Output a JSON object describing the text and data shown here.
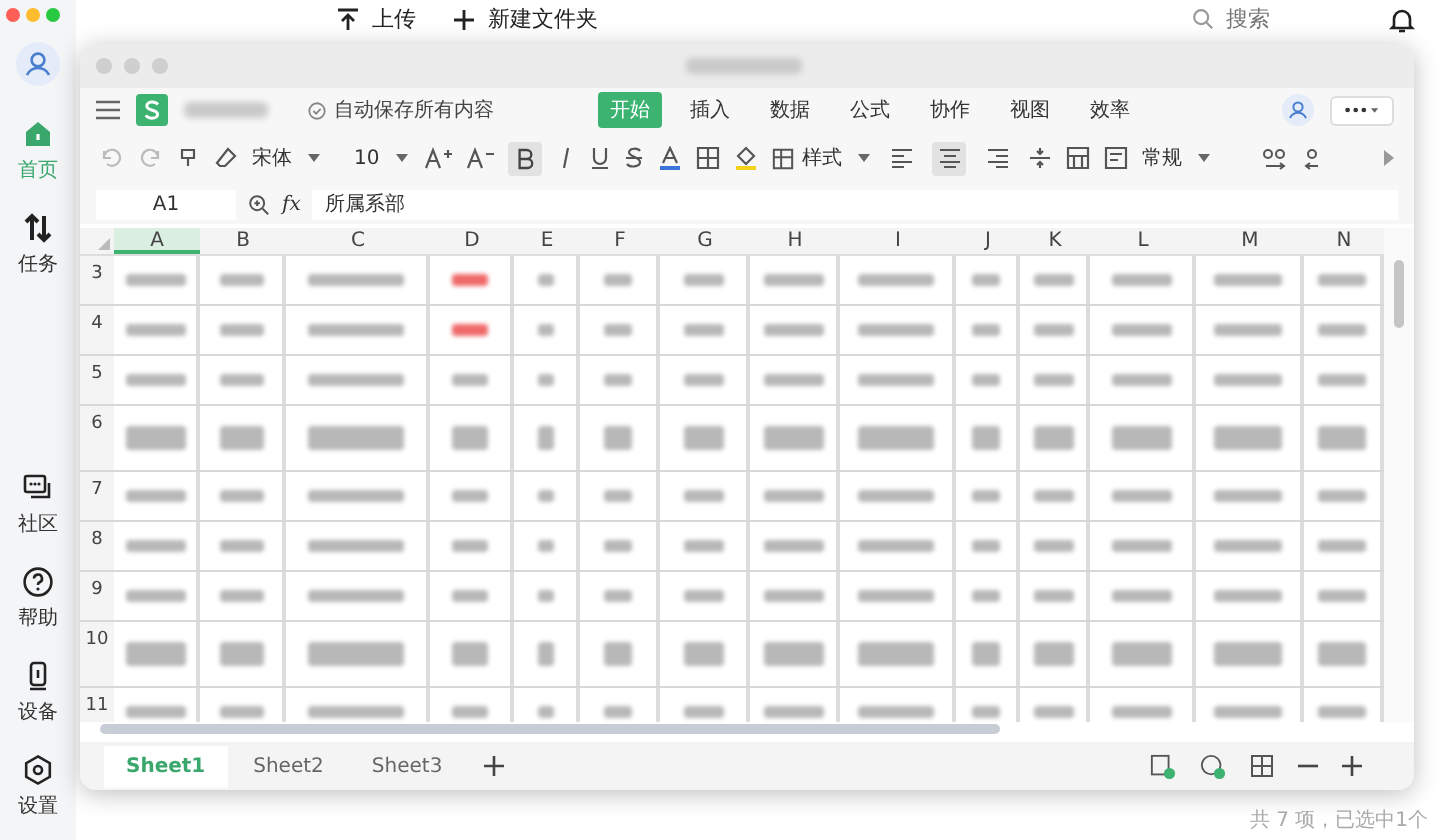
{
  "sidebar": {
    "top_items": [
      {
        "label": "首页",
        "kind": "home",
        "selected": true
      },
      {
        "label": "任务",
        "kind": "transfer",
        "selected": false
      }
    ],
    "bottom_items": [
      {
        "label": "社区",
        "kind": "chat",
        "selected": false
      },
      {
        "label": "帮助",
        "kind": "help",
        "selected": false
      },
      {
        "label": "设备",
        "kind": "device",
        "selected": false
      },
      {
        "label": "设置",
        "kind": "settings",
        "selected": false
      }
    ]
  },
  "background_toolbar": {
    "upload": "上传",
    "new_folder": "新建文件夹",
    "search": {
      "placeholder": "搜索"
    }
  },
  "status_text": "共 7 项，已选中1个",
  "editor": {
    "autosave": "自动保存所有内容",
    "menu_tabs": [
      {
        "label": "开始",
        "selected": true
      },
      {
        "label": "插入",
        "selected": false
      },
      {
        "label": "数据",
        "selected": false
      },
      {
        "label": "公式",
        "selected": false
      },
      {
        "label": "协作",
        "selected": false
      },
      {
        "label": "视图",
        "selected": false
      },
      {
        "label": "效率",
        "selected": false
      }
    ],
    "toolbar": {
      "font": "宋体",
      "size": "10",
      "style": "样式",
      "number_format": "常规",
      "bold": true,
      "align_buttons": [
        {
          "selected": false
        },
        {
          "selected": true
        },
        {
          "selected": false
        }
      ]
    },
    "formula_bar": {
      "cell_ref": "A1",
      "fx": "fx",
      "value": "所属系部"
    },
    "columns": [
      {
        "label": "A",
        "selected": true
      },
      {
        "label": "B",
        "selected": false
      },
      {
        "label": "C",
        "selected": false
      },
      {
        "label": "D",
        "selected": false
      },
      {
        "label": "E",
        "selected": false
      },
      {
        "label": "F",
        "selected": false
      },
      {
        "label": "G",
        "selected": false
      },
      {
        "label": "H",
        "selected": false
      },
      {
        "label": "I",
        "selected": false
      },
      {
        "label": "J",
        "selected": false
      },
      {
        "label": "K",
        "selected": false
      },
      {
        "label": "L",
        "selected": false
      },
      {
        "label": "M",
        "selected": false
      },
      {
        "label": "N",
        "selected": false
      }
    ],
    "rows": [
      {
        "label": "3",
        "wrapped": false,
        "flagged": true
      },
      {
        "label": "4",
        "wrapped": false,
        "flagged": true
      },
      {
        "label": "5",
        "wrapped": false,
        "flagged": false
      },
      {
        "label": "6",
        "wrapped": true,
        "flagged": false
      },
      {
        "label": "7",
        "wrapped": false,
        "flagged": false
      },
      {
        "label": "8",
        "wrapped": false,
        "flagged": false
      },
      {
        "label": "9",
        "wrapped": false,
        "flagged": false
      },
      {
        "label": "10",
        "wrapped": true,
        "flagged": false
      },
      {
        "label": "11",
        "wrapped": false,
        "flagged": false
      }
    ],
    "sheets": [
      {
        "label": "Sheet1",
        "selected": true
      },
      {
        "label": "Sheet2",
        "selected": false
      },
      {
        "label": "Sheet3",
        "selected": false
      }
    ]
  }
}
